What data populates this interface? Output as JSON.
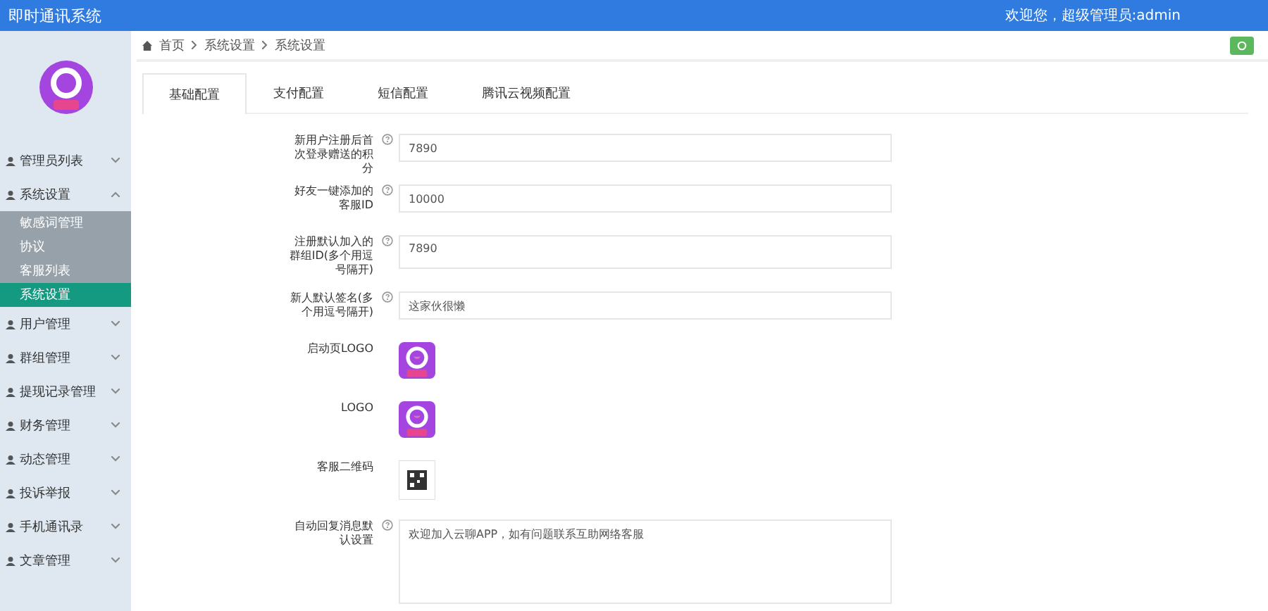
{
  "header": {
    "title": "即时通讯系统",
    "welcome": "欢迎您，超级管理员:admin"
  },
  "breadcrumb": [
    "首页",
    "系统设置",
    "系统设置"
  ],
  "sidebar": {
    "items": [
      {
        "label": "管理员列表",
        "expanded": false
      },
      {
        "label": "系统设置",
        "expanded": true,
        "children": [
          {
            "label": "敏感词管理",
            "selected": false
          },
          {
            "label": "协议",
            "selected": false
          },
          {
            "label": "客服列表",
            "selected": false
          },
          {
            "label": "系统设置",
            "selected": true
          }
        ]
      },
      {
        "label": "用户管理",
        "expanded": false
      },
      {
        "label": "群组管理",
        "expanded": false
      },
      {
        "label": "提现记录管理",
        "expanded": false
      },
      {
        "label": "财务管理",
        "expanded": false
      },
      {
        "label": "动态管理",
        "expanded": false
      },
      {
        "label": "投诉举报",
        "expanded": false
      },
      {
        "label": "手机通讯录",
        "expanded": false
      },
      {
        "label": "文章管理",
        "expanded": false
      }
    ]
  },
  "tabs": [
    {
      "label": "基础配置",
      "selected": true
    },
    {
      "label": "支付配置",
      "selected": false
    },
    {
      "label": "短信配置",
      "selected": false
    },
    {
      "label": "腾讯云视频配置",
      "selected": false
    }
  ],
  "form": [
    {
      "kind": "input",
      "label": "新用户注册后首次登录赠送的积分",
      "value": "7890"
    },
    {
      "kind": "input",
      "label": "好友一键添加的客服ID",
      "value": "10000"
    },
    {
      "kind": "textarea-small",
      "label": "注册默认加入的群组ID(多个用逗号隔开)",
      "value": "7890"
    },
    {
      "kind": "input",
      "label": "新人默认签名(多个用逗号隔开)",
      "value": "这家伙很懒"
    },
    {
      "kind": "logo",
      "label": "启动页LOGO"
    },
    {
      "kind": "logo",
      "label": "LOGO"
    },
    {
      "kind": "qr",
      "label": "客服二维码"
    },
    {
      "kind": "textarea",
      "label": "自动回复消息默认设置",
      "value": "欢迎加入云聊APP，如有问题联系互助网络客服"
    }
  ]
}
